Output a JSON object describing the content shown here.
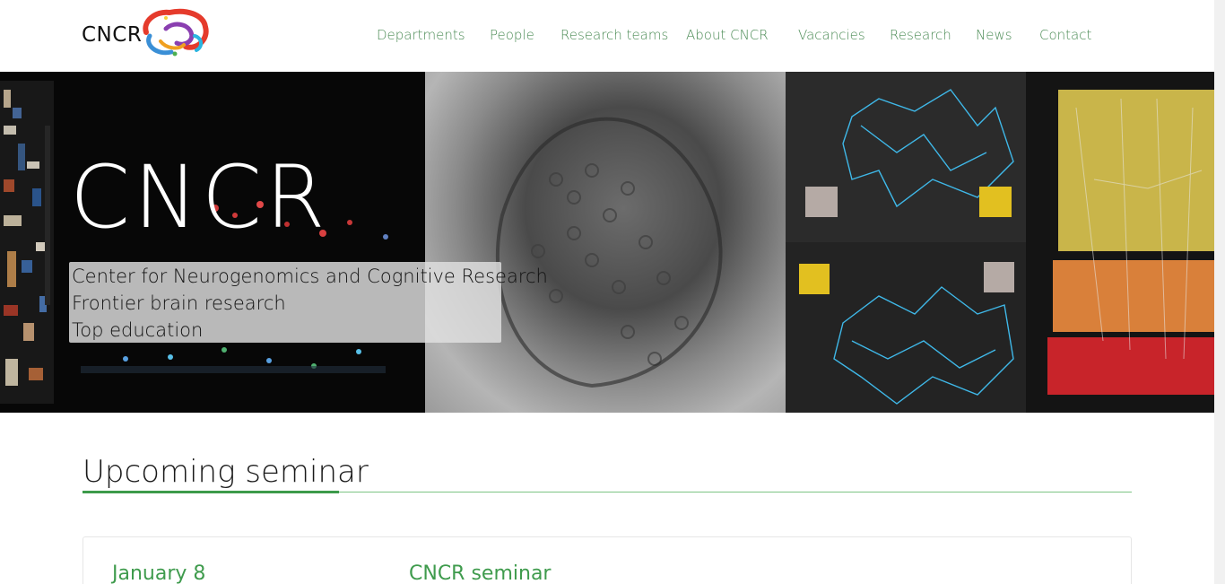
{
  "header": {
    "logo_text": "CNCR",
    "nav": [
      {
        "label": "Departments"
      },
      {
        "label": "People"
      },
      {
        "label": "Research teams"
      },
      {
        "label": "About CNCR"
      },
      {
        "label": "Vacancies"
      },
      {
        "label": "Research"
      },
      {
        "label": "News"
      },
      {
        "label": "Contact"
      }
    ]
  },
  "hero": {
    "title": "CNCR",
    "lines": [
      "Center for Neurogenomics and Cognitive Research",
      "Frontier brain research",
      "Top education"
    ]
  },
  "seminar_section": {
    "title": "Upcoming seminar",
    "items": [
      {
        "date": "January 8",
        "title": "CNCR seminar"
      }
    ]
  },
  "colors": {
    "accent_green": "#3f9b4d",
    "nav_green": "#4b8b55",
    "rule_green": "#7cc484"
  },
  "icons": {
    "logo": "cncr-brain-logo"
  }
}
